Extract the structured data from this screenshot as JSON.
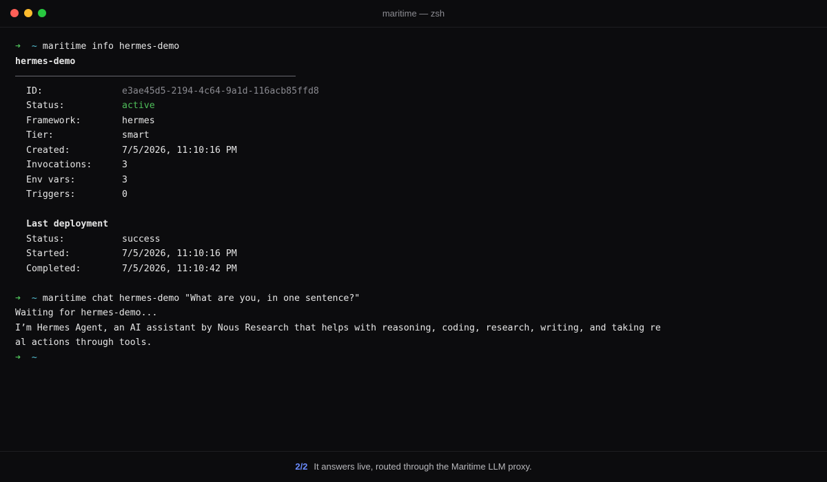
{
  "window": {
    "title": "maritime — zsh"
  },
  "prompt": {
    "arrow": "➜",
    "dir": "~"
  },
  "commands": {
    "info": "maritime info hermes-demo",
    "chat": "maritime chat hermes-demo \"What are you, in one sentence?\""
  },
  "info": {
    "heading": "hermes-demo",
    "fields": [
      {
        "key": "ID:",
        "value": "e3ae45d5-2194-4c64-9a1d-116acb85ffd8"
      },
      {
        "key": "Status:",
        "value": "active"
      },
      {
        "key": "Framework:",
        "value": "hermes"
      },
      {
        "key": "Tier:",
        "value": "smart"
      },
      {
        "key": "Created:",
        "value": "7/5/2026, 11:10:16 PM"
      },
      {
        "key": "Invocations:",
        "value": "3"
      },
      {
        "key": "Env vars:",
        "value": "3"
      },
      {
        "key": "Triggers:",
        "value": "0"
      }
    ],
    "deployment": {
      "heading": "Last deployment",
      "fields": [
        {
          "key": "Status:",
          "value": "success"
        },
        {
          "key": "Started:",
          "value": "7/5/2026, 11:10:16 PM"
        },
        {
          "key": "Completed:",
          "value": "7/5/2026, 11:10:42 PM"
        }
      ]
    }
  },
  "chat": {
    "waiting": "Waiting for hermes-demo...",
    "response_lines": [
      "I’m Hermes Agent, an AI assistant by Nous Research that helps with reasoning, coding, research, writing, and taking re",
      "al actions through tools."
    ]
  },
  "footer": {
    "step": "2/2",
    "caption": "It answers live, routed through the Maritime LLM proxy."
  },
  "colors": {
    "background": "#0c0c0e",
    "prompt_arrow": "#4fbf5a",
    "prompt_dir": "#56c2d6",
    "status_active": "#4fbf5a",
    "muted_value": "#8a8a90",
    "step_accent": "#6b8cff"
  }
}
